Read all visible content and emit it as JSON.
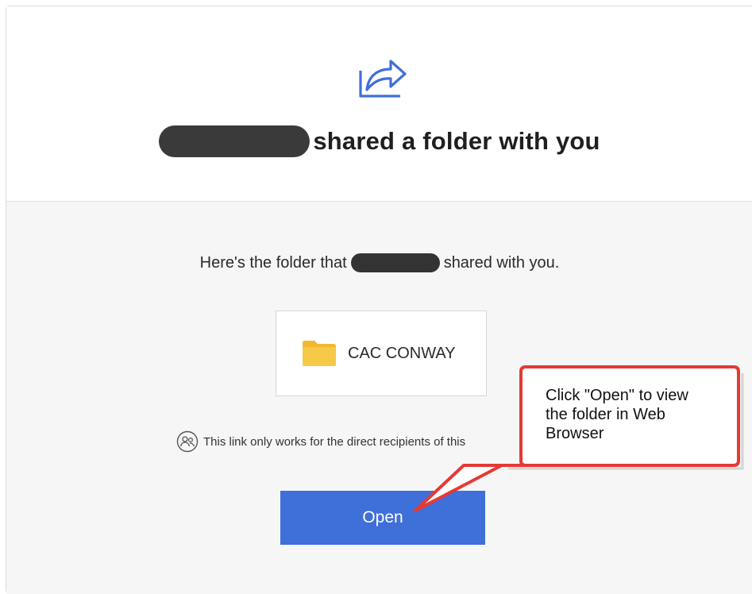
{
  "header": {
    "share_icon": "share-arrow-icon",
    "title_suffix": "shared a folder with you"
  },
  "body": {
    "intro_prefix": "Here's the folder that",
    "intro_suffix": "shared with you.",
    "folder": {
      "icon": "folder-icon",
      "name": "CAC CONWAY"
    },
    "note": {
      "icon": "people-icon",
      "text": "This link only works for the direct recipients of this"
    },
    "open_label": "Open"
  },
  "callout": {
    "text_line1": "Click \"Open\" to view",
    "text_line2": "the folder in Web",
    "text_line3": "Browser"
  },
  "colors": {
    "accent": "#3f6fd9",
    "folder": "#f7c948",
    "callout_border": "#e53935"
  }
}
